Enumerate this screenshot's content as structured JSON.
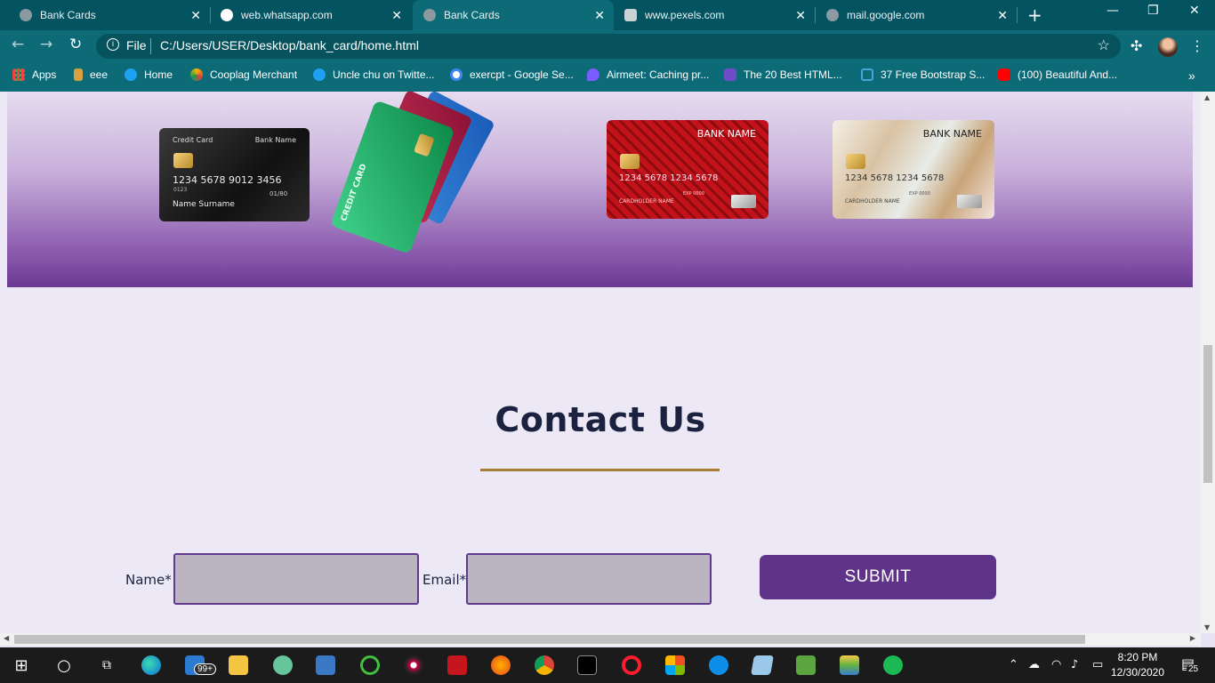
{
  "tabs": [
    {
      "title": "Bank Cards",
      "active": false
    },
    {
      "title": "web.whatsapp.com",
      "active": false
    },
    {
      "title": "Bank Cards",
      "active": true
    },
    {
      "title": "www.pexels.com",
      "active": false
    },
    {
      "title": "mail.google.com",
      "active": false
    }
  ],
  "address_bar": {
    "scheme": "File",
    "url": "C:/Users/USER/Desktop/bank_card/home.html"
  },
  "bookmarks": [
    {
      "label": "Apps",
      "icon": "apps-grid-icon"
    },
    {
      "label": "eee",
      "icon": "bookmark-icon"
    },
    {
      "label": "Home",
      "icon": "twitter-icon"
    },
    {
      "label": "Cooplag Merchant",
      "icon": "cooplag-icon"
    },
    {
      "label": "Uncle chu on Twitte...",
      "icon": "twitter-icon"
    },
    {
      "label": "exercpt - Google Se...",
      "icon": "google-icon"
    },
    {
      "label": "Airmeet: Caching pr...",
      "icon": "airmeet-icon"
    },
    {
      "label": "The 20 Best HTML...",
      "icon": "bookmark-icon"
    },
    {
      "label": "37 Free Bootstrap S...",
      "icon": "bookmark-icon"
    },
    {
      "label": "(100) Beautiful And...",
      "icon": "youtube-icon"
    }
  ],
  "cards": {
    "black": {
      "type_label": "Credit Card",
      "bank": "Bank Name",
      "number": "1234  5678  9012  3456",
      "small_code": "0123",
      "expiry": "01/80",
      "holder": "Name Surname"
    },
    "fan_label": "CREDIT CARD",
    "red": {
      "bank": "BANK NAME",
      "number": "1234  5678  1234  5678",
      "holder": "CARDHOLDER NAME",
      "exp": "EXP 0000"
    },
    "silver": {
      "bank": "BANK NAME",
      "number": "1234  5678  1234  5678",
      "holder": "CARDHOLDER NAME",
      "exp": "EXP 0000"
    }
  },
  "contact": {
    "title": "Contact Us",
    "name_label": "Name*",
    "email_label": "Email*",
    "name_value": "",
    "email_value": "",
    "submit_label": "SUBMIT"
  },
  "colors": {
    "accent_purple": "#5e3388",
    "underline_gold": "#a77d35",
    "chrome_teal": "#0d6a77"
  },
  "taskbar": {
    "mail_badge": "99+",
    "time": "8:20 PM",
    "date": "12/30/2020",
    "notifications": "25"
  }
}
